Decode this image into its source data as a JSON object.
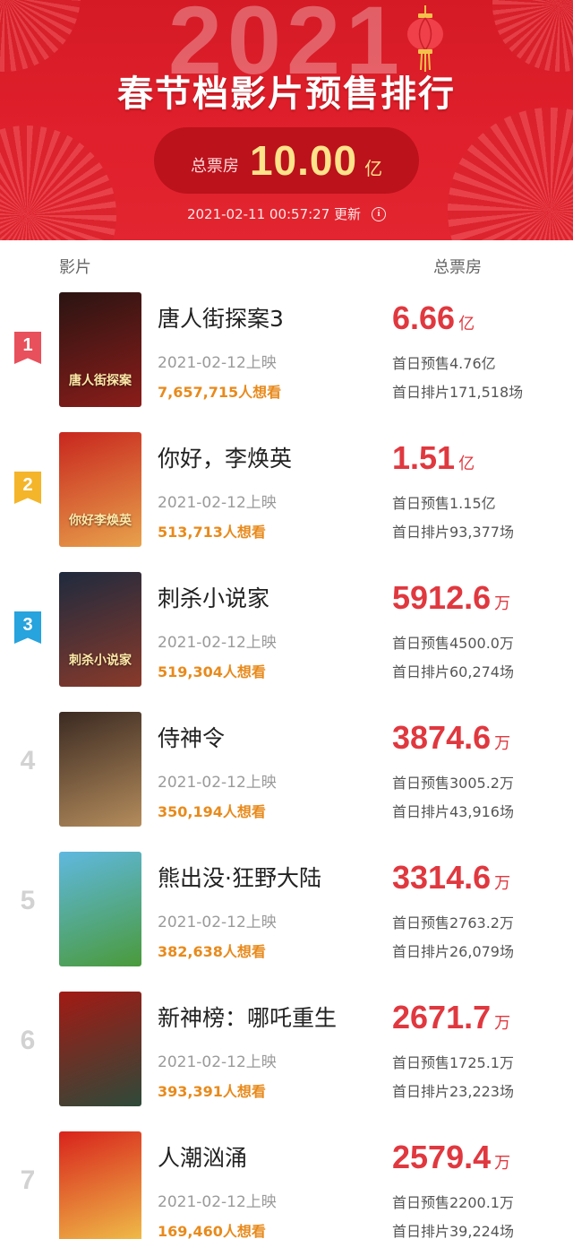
{
  "header": {
    "year": "2021",
    "title": "春节档影片预售排行",
    "box_office_label": "总票房",
    "box_office_value": "10.00",
    "box_office_unit": "亿",
    "update_time": "2021-02-11 00:57:27 更新",
    "colors": {
      "bg": "#e0202c",
      "pill": "#bb121c",
      "value": "#ffe38a"
    }
  },
  "columns": {
    "film": "影片",
    "total": "总票房"
  },
  "badge_colors": [
    "#e8505b",
    "#f4b52a",
    "#27a3dd"
  ],
  "movies": [
    {
      "rank": "1",
      "title": "唐人街探案3",
      "release": "2021-02-12上映",
      "want": "7,657,715人想看",
      "total_value": "6.66",
      "total_unit": "亿",
      "presale": "首日预售4.76亿",
      "shows": "首日排片171,518场",
      "poster_text": "唐人街探案",
      "poster_colors": [
        "#2a1412",
        "#8b1d1a"
      ]
    },
    {
      "rank": "2",
      "title": "你好，李焕英",
      "release": "2021-02-12上映",
      "want": "513,713人想看",
      "total_value": "1.51",
      "total_unit": "亿",
      "presale": "首日预售1.15亿",
      "shows": "首日排片93,377场",
      "poster_text": "你好李焕英",
      "poster_colors": [
        "#c8261e",
        "#e8a24c"
      ]
    },
    {
      "rank": "3",
      "title": "刺杀小说家",
      "release": "2021-02-12上映",
      "want": "519,304人想看",
      "total_value": "5912.6",
      "total_unit": "万",
      "presale": "首日预售4500.0万",
      "shows": "首日排片60,274场",
      "poster_text": "刺杀小说家",
      "poster_colors": [
        "#1e2a3e",
        "#8a3a2a"
      ]
    },
    {
      "rank": "4",
      "title": "侍神令",
      "release": "2021-02-12上映",
      "want": "350,194人想看",
      "total_value": "3874.6",
      "total_unit": "万",
      "presale": "首日预售3005.2万",
      "shows": "首日排片43,916场",
      "poster_text": "",
      "poster_colors": [
        "#3b2a22",
        "#b48c5c"
      ]
    },
    {
      "rank": "5",
      "title": "熊出没·狂野大陆",
      "release": "2021-02-12上映",
      "want": "382,638人想看",
      "total_value": "3314.6",
      "total_unit": "万",
      "presale": "首日预售2763.2万",
      "shows": "首日排片26,079场",
      "poster_text": "",
      "poster_colors": [
        "#5fb8e0",
        "#4a9a3a"
      ]
    },
    {
      "rank": "6",
      "title": "新神榜：哪吒重生",
      "release": "2021-02-12上映",
      "want": "393,391人想看",
      "total_value": "2671.7",
      "total_unit": "万",
      "presale": "首日预售1725.1万",
      "shows": "首日排片23,223场",
      "poster_text": "",
      "poster_colors": [
        "#a21a14",
        "#2e4a3a"
      ]
    },
    {
      "rank": "7",
      "title": "人潮汹涌",
      "release": "2021-02-12上映",
      "want": "169,460人想看",
      "total_value": "2579.4",
      "total_unit": "万",
      "presale": "首日预售2200.1万",
      "shows": "首日排片39,224场",
      "poster_text": "",
      "poster_colors": [
        "#d8231c",
        "#f0c24a"
      ]
    }
  ]
}
